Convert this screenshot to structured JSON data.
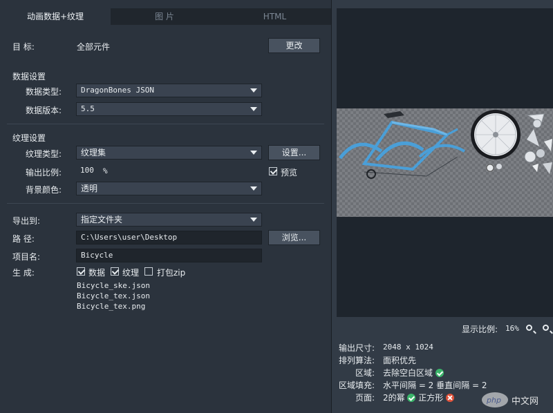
{
  "tabs": [
    "动画数据+纹理",
    "图 片",
    "HTML"
  ],
  "target": {
    "label": "目  标:",
    "value": "全部元件",
    "change_button": "更改"
  },
  "data_settings": {
    "title": "数据设置",
    "type_label": "数据类型:",
    "type_value": "DragonBones JSON",
    "version_label": "数据版本:",
    "version_value": "5.5"
  },
  "texture_settings": {
    "title": "纹理设置",
    "type_label": "纹理类型:",
    "type_value": "纹理集",
    "settings_button": "设置...",
    "scale_label": "输出比例:",
    "scale_value": "100",
    "scale_unit": "%",
    "preview_label": "预览",
    "preview_checked": true,
    "bg_label": "背景颜色:",
    "bg_value": "透明"
  },
  "export": {
    "export_to_label": "导出到:",
    "export_to_value": "指定文件夹",
    "path_label": "路  径:",
    "path_value": "C:\\Users\\user\\Desktop",
    "browse_button": "浏览...",
    "project_label": "项目名:",
    "project_value": "Bicycle",
    "generate_label": "生  成:",
    "options": [
      {
        "label": "数据",
        "checked": true
      },
      {
        "label": "纹理",
        "checked": true
      },
      {
        "label": "打包zip",
        "checked": false
      }
    ],
    "files": [
      "Bicycle_ske.json",
      "Bicycle_tex.json",
      "Bicycle_tex.png"
    ]
  },
  "preview_panel": {
    "zoom_label": "显示比例:",
    "zoom_value": "16%",
    "info": [
      {
        "key": "输出尺寸:",
        "value": "2048 x 1024"
      },
      {
        "key": "排列算法:",
        "value": "面积优先"
      },
      {
        "key": "区域:",
        "value": "去除空白区域"
      },
      {
        "key": "区域填充:",
        "value": "水平间隔 = 2 垂直间隔 = 2"
      },
      {
        "key": "页面:",
        "value": "2的幂",
        "value2": "正方形"
      }
    ]
  },
  "watermark": {
    "text": "中文网",
    "logo": "php"
  },
  "colors": {
    "accent_blue": "#4a9fd8",
    "ok_green": "#3bb56a",
    "error_red": "#e0523a"
  }
}
